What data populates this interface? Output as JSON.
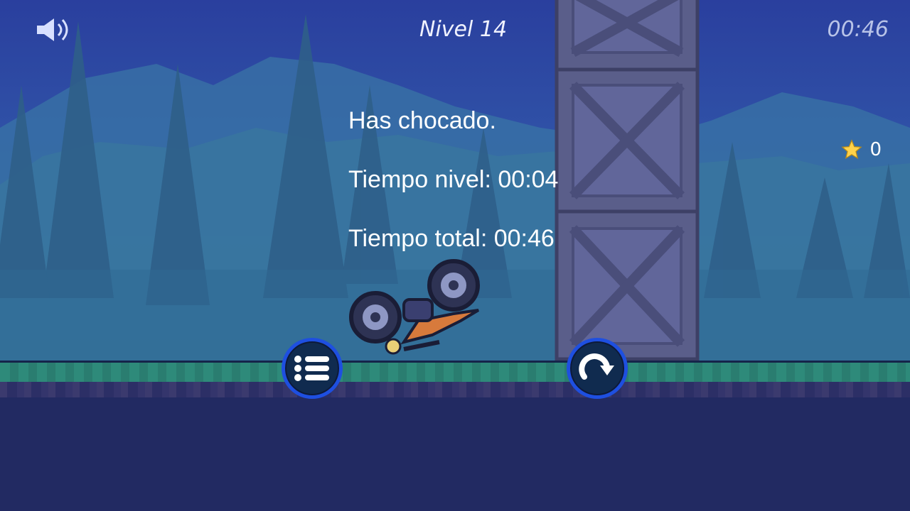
{
  "hud": {
    "level_label": "Nivel 14",
    "timer": "00:46",
    "stars_count": "0"
  },
  "crash_panel": {
    "line1": "Has chocado.",
    "line2": "Tiempo nivel: 00:04",
    "line3": "Tiempo total: 00:46"
  },
  "buttons": {
    "menu_icon": "list-icon",
    "restart_icon": "restart-icon",
    "sound_icon": "speaker-icon"
  },
  "colors": {
    "sky": "#2a3f9e",
    "ground": "#222a62",
    "grass": "#2e8a7a",
    "button_fill": "#102b4f",
    "button_ring": "#1e4fe0",
    "bike_body": "#d77a3c"
  }
}
